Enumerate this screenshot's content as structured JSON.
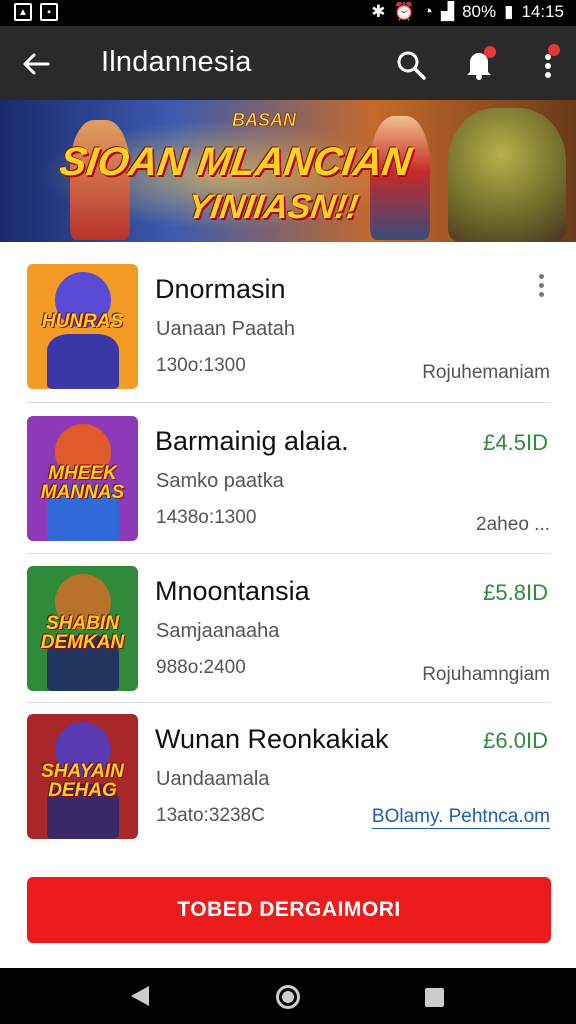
{
  "status_bar": {
    "battery": "80%",
    "time": "14:15"
  },
  "app_bar": {
    "title": "Ilndannesia"
  },
  "banner": {
    "subtitle": "BASAN",
    "line1": "SIOAN MLANCIAN",
    "line2": "YINIIASN!!"
  },
  "items": [
    {
      "title": "Dnormasin",
      "subtitle": "Uanaan Paatah",
      "meta": "130o:1300",
      "price": "",
      "right_note": "Rojuhemaniam",
      "thumb_text": "HUNRAS",
      "colors": {
        "bg": "#f29b25",
        "hero": "#5a4bd6",
        "body": "#3a38a8"
      }
    },
    {
      "title": "Barmainig alaia.",
      "subtitle": "Samko paatka",
      "meta": "1438o:1300",
      "price": "£4.5ID",
      "right_note": "2aheo ...",
      "thumb_text": "MHEEK MANNAS",
      "colors": {
        "bg": "#8e3ab8",
        "hero": "#e05a2a",
        "body": "#2f6ad8"
      }
    },
    {
      "title": "Mnoontansia",
      "subtitle": "Samjaanaaha",
      "meta": "988o:2400",
      "price": "£5.8ID",
      "right_note": "Rojuhamngiam",
      "thumb_text": "SHABIN DEMKAN",
      "colors": {
        "bg": "#2f8a3a",
        "hero": "#b8722a",
        "body": "#22355e"
      }
    },
    {
      "title": "Wunan Reonkakiak",
      "subtitle": "Uandaamala",
      "meta": "13ato:3238C",
      "price": "£6.0ID",
      "link": "BOlamy. Pehtnca.om",
      "thumb_text": "SHAYAIN DEHAG",
      "colors": {
        "bg": "#a8282a",
        "hero": "#5a3ab0",
        "body": "#3a2a68"
      }
    }
  ],
  "cta": {
    "label": "TOBED DERGAIMORI"
  },
  "theme": {
    "accent": "#ec1c1c",
    "price_green": "#2e8b3e",
    "link_blue": "#1f5fb0",
    "app_bar": "#2a2a2a"
  }
}
